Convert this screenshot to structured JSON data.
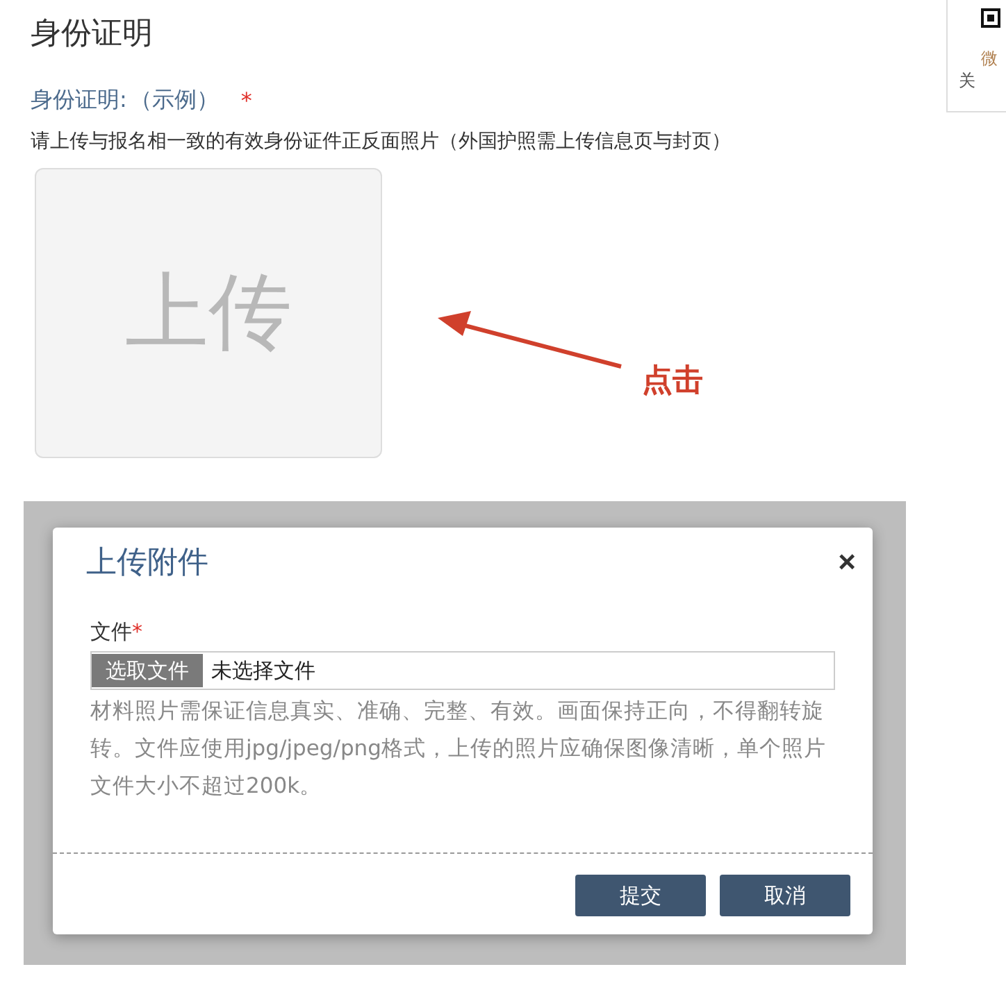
{
  "page": {
    "title": "身份证明"
  },
  "field": {
    "label": "身份证明:",
    "example_link": "（示例）",
    "required_mark": "*",
    "hint": "请上传与报名相一致的有效身份证件正反面照片（外国护照需上传信息页与封页）"
  },
  "upload_tile": {
    "label": "上传"
  },
  "callout": {
    "text": "点击"
  },
  "side_card": {
    "lines": [
      "微",
      "关"
    ]
  },
  "dialog": {
    "title": "上传附件",
    "close": "×",
    "file_label": "文件",
    "required_mark": "*",
    "choose_button": "选取文件",
    "file_status": "未选择文件",
    "help": "材料照片需保证信息真实、准确、完整、有效。画面保持正向，不得翻转旋转。文件应使用jpg/jpeg/png格式，上传的照片应确保图像清晰，单个照片文件大小不超过200k。",
    "buttons": [
      "提交",
      "取消"
    ]
  }
}
